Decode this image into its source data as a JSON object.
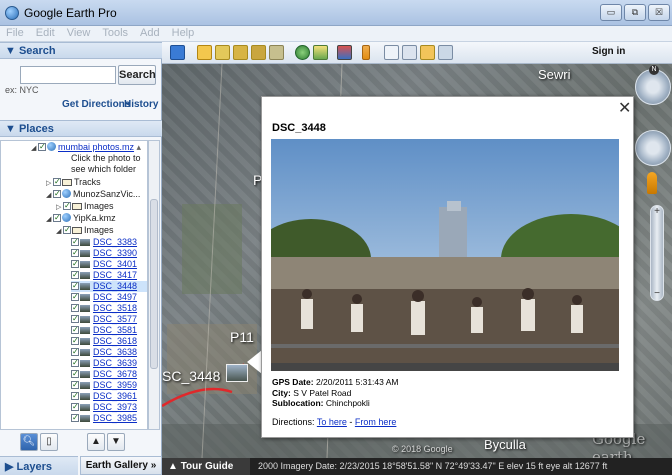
{
  "window": {
    "title": "Google Earth Pro",
    "buttons": [
      "▭",
      "⧉",
      "☒"
    ]
  },
  "menu": [
    "File",
    "Edit",
    "View",
    "Tools",
    "Add",
    "Help"
  ],
  "search": {
    "header": "▼ Search",
    "button": "Search",
    "example": "ex: NYC",
    "get_directions": "Get Directions",
    "history": "History"
  },
  "places": {
    "header": "▼ Places",
    "tree": [
      {
        "label": "mumbai photos.mz",
        "link": true
      },
      {
        "label": "Click the photo to"
      },
      {
        "label": "see which folder"
      },
      {
        "label": "Tracks"
      },
      {
        "label": "MunozSanzVic..."
      },
      {
        "label": "Images"
      },
      {
        "label": "YipKa.kmz"
      },
      {
        "label": "Images"
      }
    ],
    "photos": [
      "DSC_3383",
      "DSC_3390",
      "DSC_3401",
      "DSC_3417",
      "DSC_3448",
      "DSC_3497",
      "DSC_3518",
      "DSC_3577",
      "DSC_3581",
      "DSC_3618",
      "DSC_3638",
      "DSC_3639",
      "DSC_3678",
      "DSC_3959",
      "DSC_3961",
      "DSC_3973",
      "DSC_3985"
    ],
    "selected_photo": "DSC_3448"
  },
  "layers": {
    "header": "▶ Layers",
    "gallery_button": "Earth Gallery »"
  },
  "toolbar": {
    "sign_in": "Sign in"
  },
  "map": {
    "labels": {
      "sewri": "Sewri",
      "byculla": "Byculla",
      "p1": "P11",
      "p_letter": "P",
      "photo_label": "SC_3448",
      "watermark": "Google earth",
      "copyright": "© 2018 Google"
    }
  },
  "statusbar": {
    "tour_guide": "Tour Guide",
    "text": "2000  Imagery Date: 2/23/2015    18°58'51.58\" N   72°49'33.47\" E  elev   15 ft    eye alt  12677 ft"
  },
  "balloon": {
    "title": "DSC_3448",
    "gps_label": "GPS Date:",
    "gps_value": "2/20/2011 5:31:43 AM",
    "city_label": "City:",
    "city_value": "S V Patel Road",
    "subloc_label": "Sublocation:",
    "subloc_value": "Chinchpokli",
    "directions_label": "Directions:",
    "to_here": "To here",
    "separator": " - ",
    "from_here": "From here"
  }
}
